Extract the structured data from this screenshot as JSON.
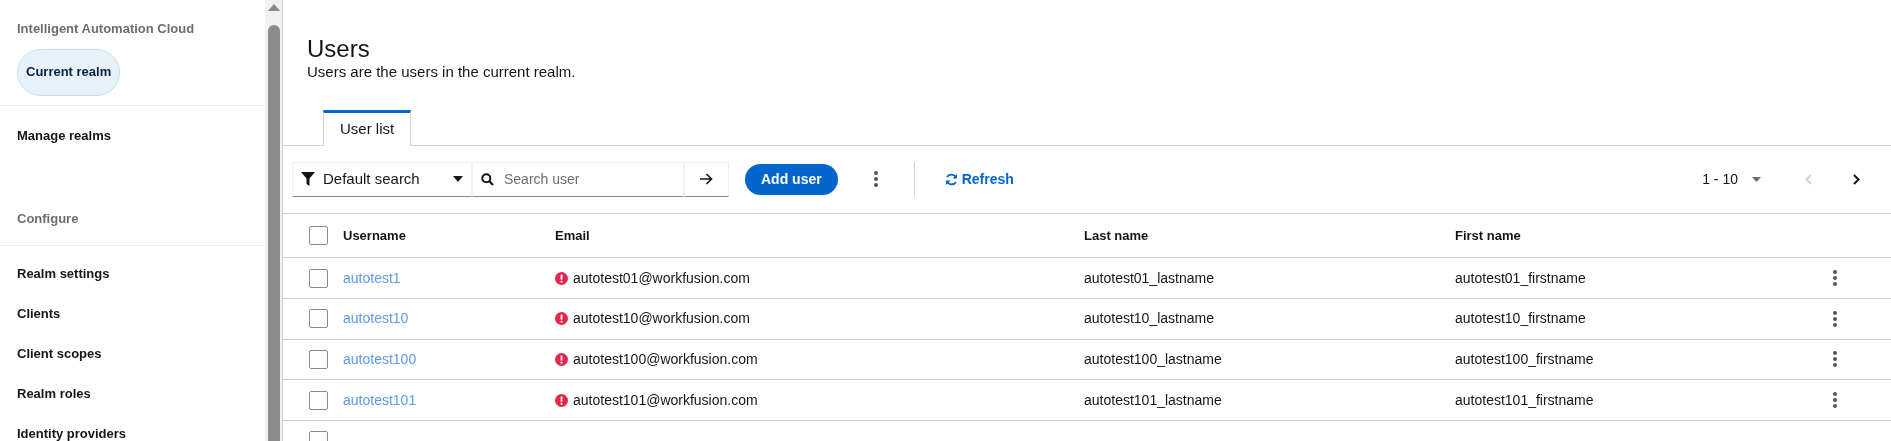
{
  "sidebar": {
    "realm_group_title": "Intelligent Automation Cloud",
    "current_realm": {
      "label": "Current realm",
      "selected": true
    },
    "manage_realms": "Manage realms",
    "section_title": "Configure",
    "items": [
      {
        "label": "Realm settings"
      },
      {
        "label": "Clients"
      },
      {
        "label": "Client scopes"
      },
      {
        "label": "Realm roles"
      },
      {
        "label": "Identity providers"
      }
    ]
  },
  "page": {
    "title": "Users",
    "subtitle": "Users are the users in the current realm."
  },
  "tabs": [
    {
      "label": "User list",
      "selected": true
    }
  ],
  "toolbar": {
    "filter": "Default search",
    "search": {
      "placeholder": "Search user"
    },
    "add_button": "Add user",
    "refresh": "Refresh",
    "pagination": "1 - 10",
    "prev_disabled": true
  },
  "table": {
    "columns": [
      "Username",
      "Email",
      "Last name",
      "First name"
    ],
    "header_checked": false,
    "rows": [
      {
        "checked": false,
        "username": "autotest1",
        "email": "autotest01@workfusion.com",
        "email_verified": false,
        "last_name": "autotest01_lastname",
        "first_name": "autotest01_firstname"
      },
      {
        "checked": false,
        "username": "autotest10",
        "email": "autotest10@workfusion.com",
        "email_verified": false,
        "last_name": "autotest10_lastname",
        "first_name": "autotest10_firstname"
      },
      {
        "checked": false,
        "username": "autotest100",
        "email": "autotest100@workfusion.com",
        "email_verified": false,
        "last_name": "autotest100_lastname",
        "first_name": "autotest100_firstname"
      },
      {
        "checked": false,
        "username": "autotest101",
        "email": "autotest101@workfusion.com",
        "email_verified": false,
        "last_name": "autotest101_lastname",
        "first_name": "autotest101_firstname"
      }
    ],
    "partial_row": {
      "checked": false
    }
  }
}
